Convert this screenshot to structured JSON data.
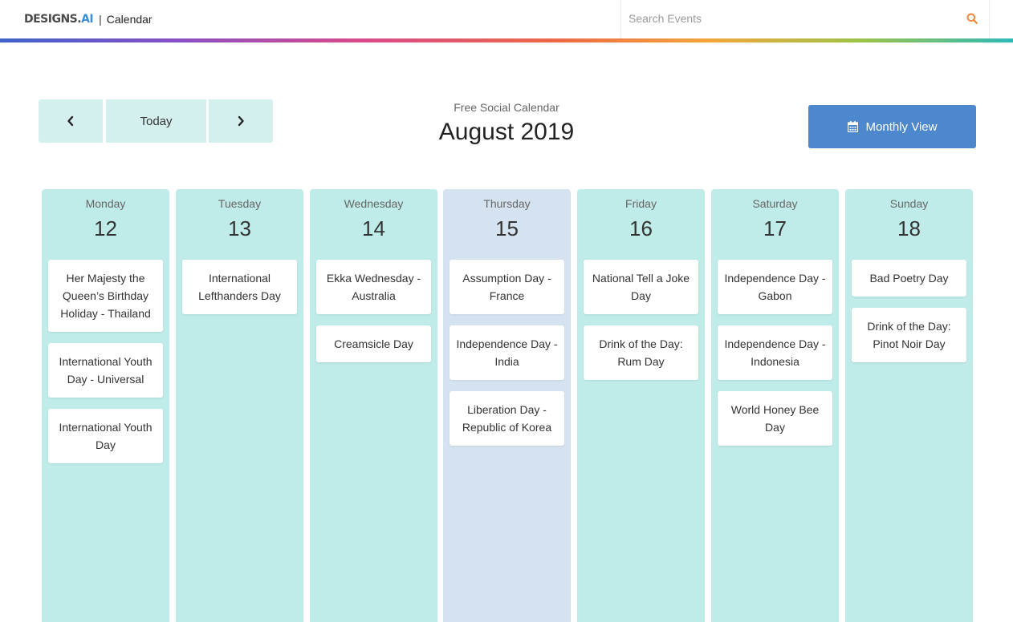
{
  "header": {
    "logo_text": "DESIGNS.",
    "logo_ai": "AI",
    "separator": "|",
    "app_title": "Calendar",
    "search_placeholder": "Search Events"
  },
  "toolbar": {
    "today_label": "Today",
    "subtitle": "Free Social Calendar",
    "month_title": "August 2019",
    "monthly_view_label": "Monthly View"
  },
  "colors": {
    "column_bg": "#bfebe8",
    "today_column_bg": "#d5e3f1",
    "nav_button_bg": "#d3f0ef",
    "primary_button": "#4d87cd",
    "search_icon": "#f0883a"
  },
  "days": [
    {
      "name": "Monday",
      "date": "12",
      "events": [
        "Her Majesty the Queen’s Birthday Holiday - Thailand",
        "International Youth Day - Universal",
        "International Youth Day"
      ]
    },
    {
      "name": "Tuesday",
      "date": "13",
      "events": [
        "International Lefthanders Day"
      ]
    },
    {
      "name": "Wednesday",
      "date": "14",
      "events": [
        "Ekka Wednesday - Australia",
        "Creamsicle Day"
      ]
    },
    {
      "name": "Thursday",
      "date": "15",
      "today": true,
      "events": [
        "Assumption Day - France",
        "Independence Day - India",
        "Liberation Day - Republic of Korea"
      ]
    },
    {
      "name": "Friday",
      "date": "16",
      "events": [
        "National Tell a Joke Day",
        "Drink of the Day: Rum Day"
      ]
    },
    {
      "name": "Saturday",
      "date": "17",
      "events": [
        "Independence Day - Gabon",
        "Independence Day - Indonesia",
        "World Honey Bee Day"
      ]
    },
    {
      "name": "Sunday",
      "date": "18",
      "events": [
        "Bad Poetry Day",
        "Drink of the Day: Pinot Noir Day"
      ]
    }
  ],
  "icons": {
    "prev": "chevron-left-icon",
    "next": "chevron-right-icon",
    "search": "search-icon",
    "calendar": "calendar-icon"
  }
}
